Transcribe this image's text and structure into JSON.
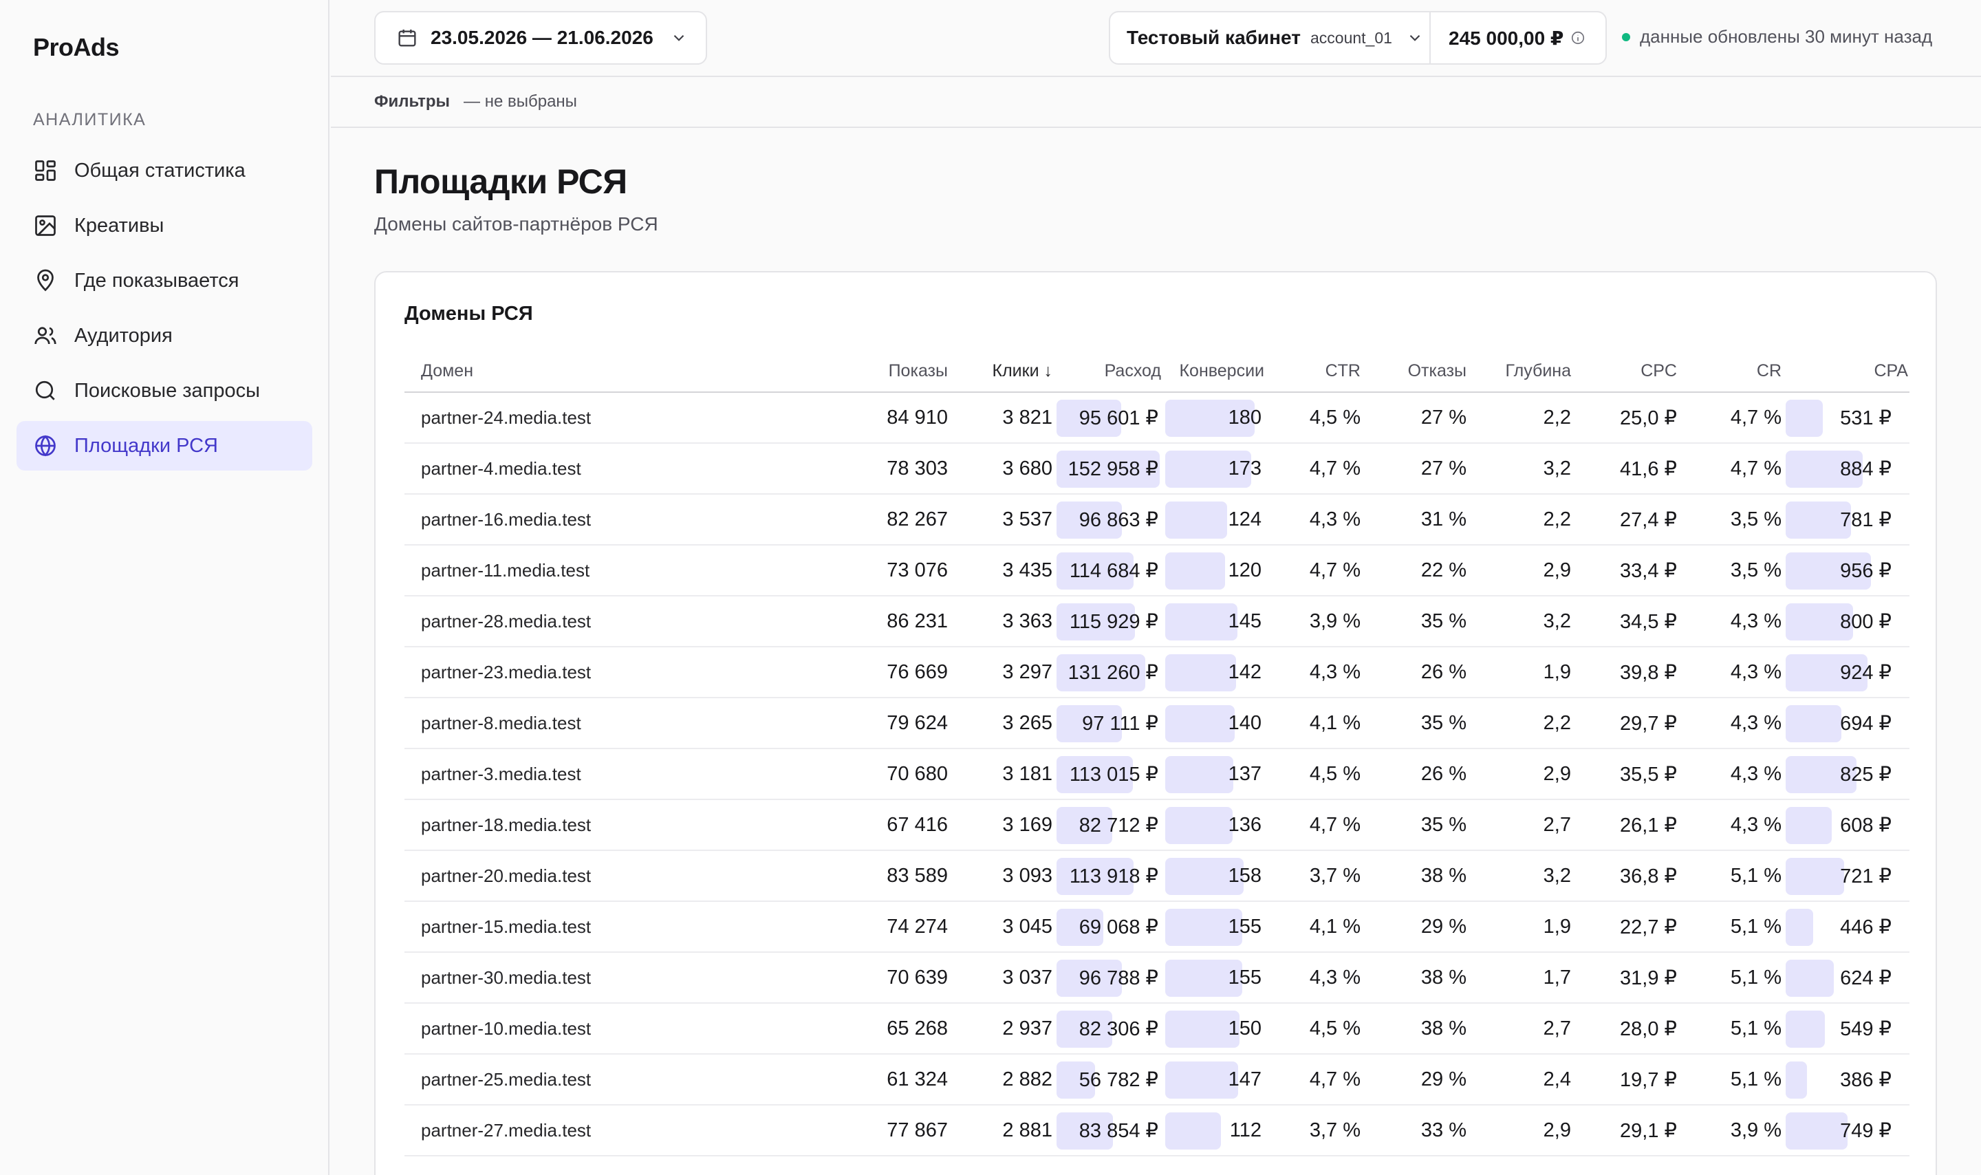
{
  "app": {
    "logo": "ProAds"
  },
  "sidebar": {
    "section": "АНАЛИТИКА",
    "items": [
      {
        "label": "Общая статистика",
        "icon": "dashboard-icon"
      },
      {
        "label": "Креативы",
        "icon": "image-icon"
      },
      {
        "label": "Где показывается",
        "icon": "map-pin-icon"
      },
      {
        "label": "Аудитория",
        "icon": "users-icon"
      },
      {
        "label": "Поисковые запросы",
        "icon": "search-icon"
      },
      {
        "label": "Площадки РСЯ",
        "icon": "globe-icon",
        "active": true
      }
    ]
  },
  "header": {
    "date_range": "23.05.2026 — 21.06.2026",
    "account_name": "Тестовый кабинет",
    "account_id": "account_01",
    "balance": "245 000,00 ₽",
    "status": "данные обновлены 30 минут назад",
    "status_color": "#10b981"
  },
  "filters": {
    "label": "Фильтры",
    "value": "— не выбраны"
  },
  "page": {
    "title": "Площадки РСЯ",
    "subtitle": "Домены сайтов-партнёров РСЯ"
  },
  "table": {
    "title": "Домены РСЯ",
    "columns": [
      "Домен",
      "Показы",
      "Клики ↓",
      "Расход",
      "Конверсии",
      "CTR",
      "Отказы",
      "Глубина",
      "CPC",
      "CR",
      "CPA"
    ],
    "bar_color": "#e5e4fc",
    "rows": [
      {
        "domain": "partner-24.media.test",
        "shows": "84 910",
        "clicks": "3 821",
        "spend": "95 601 ₽",
        "spend_v": 95601,
        "conv": "180",
        "conv_v": 180,
        "ctr": "4,5 %",
        "bounce": "27 %",
        "depth": "2,2",
        "cpc": "25,0 ₽",
        "cr": "4,7 %",
        "cpa": "531 ₽",
        "cpa_v": 531
      },
      {
        "domain": "partner-4.media.test",
        "shows": "78 303",
        "clicks": "3 680",
        "spend": "152 958 ₽",
        "spend_v": 152958,
        "conv": "173",
        "conv_v": 173,
        "ctr": "4,7 %",
        "bounce": "27 %",
        "depth": "3,2",
        "cpc": "41,6 ₽",
        "cr": "4,7 %",
        "cpa": "884 ₽",
        "cpa_v": 884
      },
      {
        "domain": "partner-16.media.test",
        "shows": "82 267",
        "clicks": "3 537",
        "spend": "96 863 ₽",
        "spend_v": 96863,
        "conv": "124",
        "conv_v": 124,
        "ctr": "4,3 %",
        "bounce": "31 %",
        "depth": "2,2",
        "cpc": "27,4 ₽",
        "cr": "3,5 %",
        "cpa": "781 ₽",
        "cpa_v": 781
      },
      {
        "domain": "partner-11.media.test",
        "shows": "73 076",
        "clicks": "3 435",
        "spend": "114 684 ₽",
        "spend_v": 114684,
        "conv": "120",
        "conv_v": 120,
        "ctr": "4,7 %",
        "bounce": "22 %",
        "depth": "2,9",
        "cpc": "33,4 ₽",
        "cr": "3,5 %",
        "cpa": "956 ₽",
        "cpa_v": 956
      },
      {
        "domain": "partner-28.media.test",
        "shows": "86 231",
        "clicks": "3 363",
        "spend": "115 929 ₽",
        "spend_v": 115929,
        "conv": "145",
        "conv_v": 145,
        "ctr": "3,9 %",
        "bounce": "35 %",
        "depth": "3,2",
        "cpc": "34,5 ₽",
        "cr": "4,3 %",
        "cpa": "800 ₽",
        "cpa_v": 800
      },
      {
        "domain": "partner-23.media.test",
        "shows": "76 669",
        "clicks": "3 297",
        "spend": "131 260 ₽",
        "spend_v": 131260,
        "conv": "142",
        "conv_v": 142,
        "ctr": "4,3 %",
        "bounce": "26 %",
        "depth": "1,9",
        "cpc": "39,8 ₽",
        "cr": "4,3 %",
        "cpa": "924 ₽",
        "cpa_v": 924
      },
      {
        "domain": "partner-8.media.test",
        "shows": "79 624",
        "clicks": "3 265",
        "spend": "97 111 ₽",
        "spend_v": 97111,
        "conv": "140",
        "conv_v": 140,
        "ctr": "4,1 %",
        "bounce": "35 %",
        "depth": "2,2",
        "cpc": "29,7 ₽",
        "cr": "4,3 %",
        "cpa": "694 ₽",
        "cpa_v": 694
      },
      {
        "domain": "partner-3.media.test",
        "shows": "70 680",
        "clicks": "3 181",
        "spend": "113 015 ₽",
        "spend_v": 113015,
        "conv": "137",
        "conv_v": 137,
        "ctr": "4,5 %",
        "bounce": "26 %",
        "depth": "2,9",
        "cpc": "35,5 ₽",
        "cr": "4,3 %",
        "cpa": "825 ₽",
        "cpa_v": 825
      },
      {
        "domain": "partner-18.media.test",
        "shows": "67 416",
        "clicks": "3 169",
        "spend": "82 712 ₽",
        "spend_v": 82712,
        "conv": "136",
        "conv_v": 136,
        "ctr": "4,7 %",
        "bounce": "35 %",
        "depth": "2,7",
        "cpc": "26,1 ₽",
        "cr": "4,3 %",
        "cpa": "608 ₽",
        "cpa_v": 608
      },
      {
        "domain": "partner-20.media.test",
        "shows": "83 589",
        "clicks": "3 093",
        "spend": "113 918 ₽",
        "spend_v": 113918,
        "conv": "158",
        "conv_v": 158,
        "ctr": "3,7 %",
        "bounce": "38 %",
        "depth": "3,2",
        "cpc": "36,8 ₽",
        "cr": "5,1 %",
        "cpa": "721 ₽",
        "cpa_v": 721
      },
      {
        "domain": "partner-15.media.test",
        "shows": "74 274",
        "clicks": "3 045",
        "spend": "69 068 ₽",
        "spend_v": 69068,
        "conv": "155",
        "conv_v": 155,
        "ctr": "4,1 %",
        "bounce": "29 %",
        "depth": "1,9",
        "cpc": "22,7 ₽",
        "cr": "5,1 %",
        "cpa": "446 ₽",
        "cpa_v": 446
      },
      {
        "domain": "partner-30.media.test",
        "shows": "70 639",
        "clicks": "3 037",
        "spend": "96 788 ₽",
        "spend_v": 96788,
        "conv": "155",
        "conv_v": 155,
        "ctr": "4,3 %",
        "bounce": "38 %",
        "depth": "1,7",
        "cpc": "31,9 ₽",
        "cr": "5,1 %",
        "cpa": "624 ₽",
        "cpa_v": 624
      },
      {
        "domain": "partner-10.media.test",
        "shows": "65 268",
        "clicks": "2 937",
        "spend": "82 306 ₽",
        "spend_v": 82306,
        "conv": "150",
        "conv_v": 150,
        "ctr": "4,5 %",
        "bounce": "38 %",
        "depth": "2,7",
        "cpc": "28,0 ₽",
        "cr": "5,1 %",
        "cpa": "549 ₽",
        "cpa_v": 549
      },
      {
        "domain": "partner-25.media.test",
        "shows": "61 324",
        "clicks": "2 882",
        "spend": "56 782 ₽",
        "spend_v": 56782,
        "conv": "147",
        "conv_v": 147,
        "ctr": "4,7 %",
        "bounce": "29 %",
        "depth": "2,4",
        "cpc": "19,7 ₽",
        "cr": "5,1 %",
        "cpa": "386 ₽",
        "cpa_v": 386
      },
      {
        "domain": "partner-27.media.test",
        "shows": "77 867",
        "clicks": "2 881",
        "spend": "83 854 ₽",
        "spend_v": 83854,
        "conv": "112",
        "conv_v": 112,
        "ctr": "3,7 %",
        "bounce": "33 %",
        "depth": "2,9",
        "cpc": "29,1 ₽",
        "cr": "3,9 %",
        "cpa": "749 ₽",
        "cpa_v": 749
      }
    ]
  }
}
